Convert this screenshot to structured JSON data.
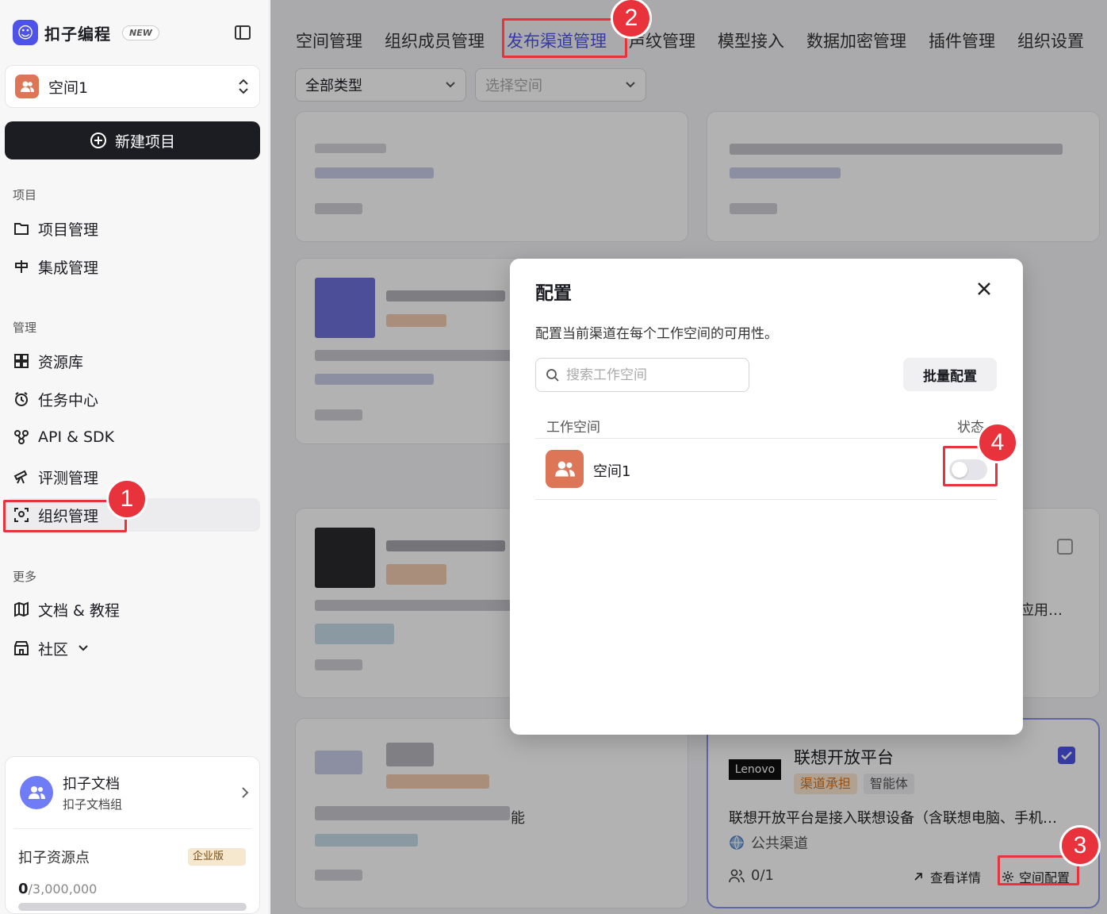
{
  "brand": {
    "name": "扣子编程",
    "new_badge": "NEW"
  },
  "space_switcher": {
    "name": "空间1"
  },
  "new_project_label": "新建项目",
  "sections": {
    "project": "项目",
    "manage": "管理",
    "more": "更多"
  },
  "nav": {
    "project_manage": "项目管理",
    "integration_manage": "集成管理",
    "resource_lib": "资源库",
    "task_center": "任务中心",
    "api_sdk": "API & SDK",
    "evaluation": "评测管理",
    "org_manage": "组织管理",
    "docs": "文档 & 教程",
    "community": "社区"
  },
  "bottom_card": {
    "doc_title": "扣子文档",
    "doc_sub": "扣子文档组",
    "points_label": "扣子资源点",
    "enterprise_badge": "企业版",
    "points_used": "0",
    "points_total": "/3,000,000",
    "points_fraction": 0
  },
  "tabs": [
    {
      "label": "空间管理"
    },
    {
      "label": "组织成员管理"
    },
    {
      "label": "发布渠道管理"
    },
    {
      "label": "声纹管理"
    },
    {
      "label": "模型接入"
    },
    {
      "label": "数据加密管理"
    },
    {
      "label": "插件管理"
    },
    {
      "label": "组织设置"
    }
  ],
  "filters": {
    "type": "全部类型",
    "space_placeholder": "选择空间"
  },
  "lenovo_card": {
    "logo": "Lenovo",
    "title": "联想开放平台",
    "tag_channel": "渠道承担",
    "tag_agent": "智能体",
    "description": "联想开放平台是接入联想设备（含联想电脑、手机…",
    "channel": "公共渠道",
    "users": "0/1",
    "view_details": "查看详情",
    "space_config": "空间配置"
  },
  "fragments": {
    "apply": "应用…",
    "able": "能"
  },
  "modal": {
    "title": "配置",
    "description": "配置当前渠道在每个工作空间的可用性。",
    "search_placeholder": "搜索工作空间",
    "batch_button": "批量配置",
    "col_workspace": "工作空间",
    "col_status": "状态",
    "rows": [
      {
        "name": "空间1",
        "enabled": false
      }
    ]
  },
  "annotations": [
    "1",
    "2",
    "3",
    "4"
  ],
  "colors": {
    "accent": "#4d53e8",
    "highlight": "#e8333c",
    "space_avatar": "#dc7656"
  }
}
